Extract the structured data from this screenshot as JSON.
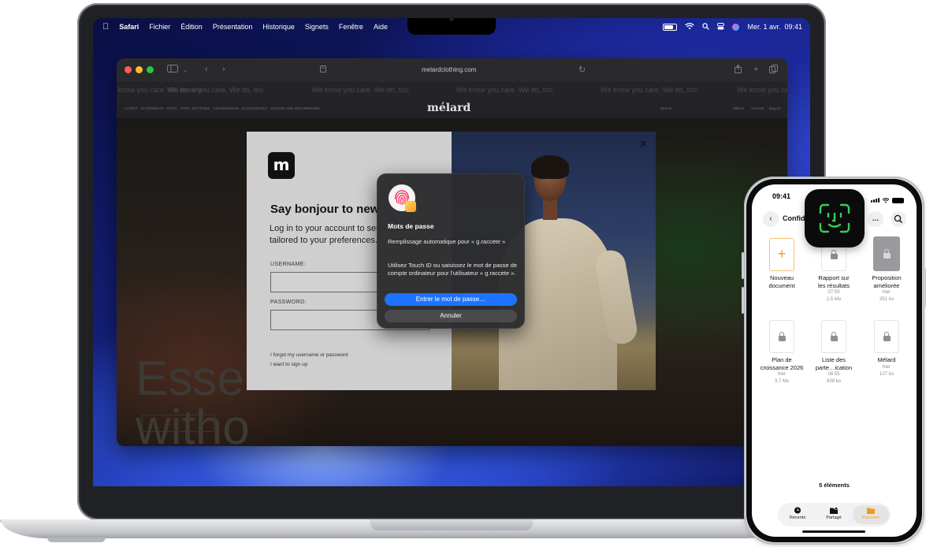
{
  "mac": {
    "menubar": {
      "app": "Safari",
      "items": [
        "Fichier",
        "Édition",
        "Présentation",
        "Historique",
        "Signets",
        "Fenêtre",
        "Aide"
      ],
      "datetime": "Mer. 1 avr.  09:41"
    },
    "safari": {
      "url": "melardclothing.com",
      "banner_text": "We know you care. We do, too.",
      "site_nav": {
        "logo": "mélard",
        "links": [
          "LATEST",
          "OUTERWEAR",
          "KNITS",
          "TOPS",
          "BOTTOMS",
          "LOUNGEWEAR",
          "ACCESSORIES",
          "VINTAGE AND REFURBISHED"
        ],
        "search": "Search",
        "right_links": [
          "Mélard",
          "Account",
          "Bag (0)"
        ]
      },
      "background_text": "Esse\nwitho",
      "login_modal": {
        "logo_letter": "m",
        "title": "Say bonjour to new",
        "subtitle": "Log in to your account to see new releases tailored to your preferences.",
        "username_label": "USERNAME:",
        "password_label": "PASSWORD:",
        "forgot_link": "I forgot my username or password",
        "signup_link": "I want to sign up",
        "close": "✕"
      },
      "password_popover": {
        "title": "Mots de passe",
        "autofill_text": "Remplissage automatique pour « g.raccete »",
        "touchid_text": "Utilisez Touch ID ou saisissez le mot de passe de compte ordinateur pour l'utilisateur « g.raccete ».",
        "primary_button": "Entrer le mot de passe…",
        "secondary_button": "Annuler",
        "accent": "#1d73ff"
      }
    }
  },
  "iphone": {
    "time": "09:41",
    "title": "Confid",
    "files": [
      {
        "name": "Nouveau\ndocument",
        "date": "",
        "size": "",
        "kind": "new"
      },
      {
        "name": "Rapport sur\nles résultats",
        "date": "07:53",
        "size": "1,5 Mo",
        "kind": "locked"
      },
      {
        "name": "Proposition\naméliorée",
        "date": "hier",
        "size": "351 ko",
        "kind": "locked-gray"
      },
      {
        "name": "Plan de\ncroissance 2026",
        "date": "hier",
        "size": "3,7 Mo",
        "kind": "locked"
      },
      {
        "name": "Liste des\nparte…ication",
        "date": "08:55",
        "size": "838 ko",
        "kind": "locked"
      },
      {
        "name": "Mélard",
        "date": "hier",
        "size": "127 ko",
        "kind": "locked"
      }
    ],
    "count_label": "5 éléments",
    "tabs": [
      {
        "label": "Récents",
        "icon": "clock-icon",
        "active": false
      },
      {
        "label": "Partagé",
        "icon": "shared-folder-icon",
        "active": false
      },
      {
        "label": "Parcourir",
        "icon": "folder-icon",
        "active": true
      }
    ],
    "accent": "#f19a1a"
  }
}
